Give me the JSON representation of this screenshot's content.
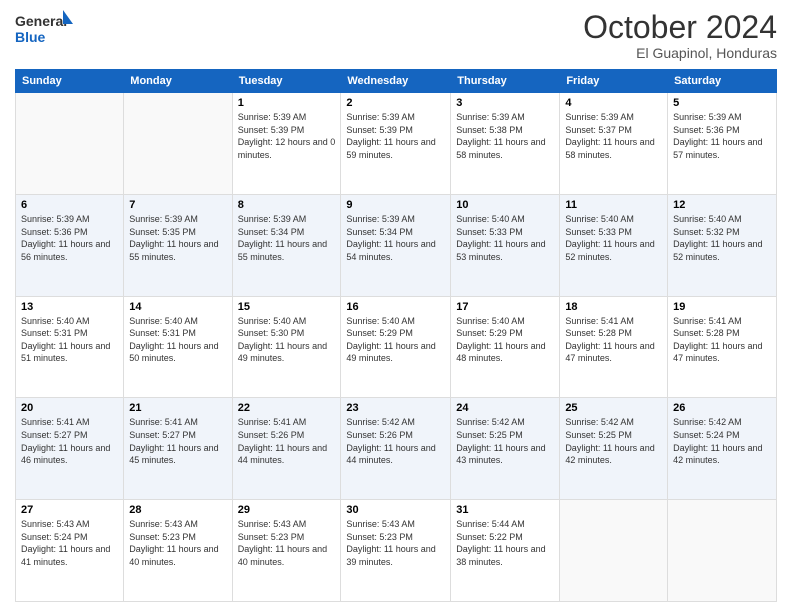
{
  "logo": {
    "line1": "General",
    "line2": "Blue"
  },
  "header": {
    "month": "October 2024",
    "location": "El Guapinol, Honduras"
  },
  "weekdays": [
    "Sunday",
    "Monday",
    "Tuesday",
    "Wednesday",
    "Thursday",
    "Friday",
    "Saturday"
  ],
  "weeks": [
    [
      {
        "day": "",
        "sunrise": "",
        "sunset": "",
        "daylight": ""
      },
      {
        "day": "",
        "sunrise": "",
        "sunset": "",
        "daylight": ""
      },
      {
        "day": "1",
        "sunrise": "Sunrise: 5:39 AM",
        "sunset": "Sunset: 5:39 PM",
        "daylight": "Daylight: 12 hours and 0 minutes."
      },
      {
        "day": "2",
        "sunrise": "Sunrise: 5:39 AM",
        "sunset": "Sunset: 5:39 PM",
        "daylight": "Daylight: 11 hours and 59 minutes."
      },
      {
        "day": "3",
        "sunrise": "Sunrise: 5:39 AM",
        "sunset": "Sunset: 5:38 PM",
        "daylight": "Daylight: 11 hours and 58 minutes."
      },
      {
        "day": "4",
        "sunrise": "Sunrise: 5:39 AM",
        "sunset": "Sunset: 5:37 PM",
        "daylight": "Daylight: 11 hours and 58 minutes."
      },
      {
        "day": "5",
        "sunrise": "Sunrise: 5:39 AM",
        "sunset": "Sunset: 5:36 PM",
        "daylight": "Daylight: 11 hours and 57 minutes."
      }
    ],
    [
      {
        "day": "6",
        "sunrise": "Sunrise: 5:39 AM",
        "sunset": "Sunset: 5:36 PM",
        "daylight": "Daylight: 11 hours and 56 minutes."
      },
      {
        "day": "7",
        "sunrise": "Sunrise: 5:39 AM",
        "sunset": "Sunset: 5:35 PM",
        "daylight": "Daylight: 11 hours and 55 minutes."
      },
      {
        "day": "8",
        "sunrise": "Sunrise: 5:39 AM",
        "sunset": "Sunset: 5:34 PM",
        "daylight": "Daylight: 11 hours and 55 minutes."
      },
      {
        "day": "9",
        "sunrise": "Sunrise: 5:39 AM",
        "sunset": "Sunset: 5:34 PM",
        "daylight": "Daylight: 11 hours and 54 minutes."
      },
      {
        "day": "10",
        "sunrise": "Sunrise: 5:40 AM",
        "sunset": "Sunset: 5:33 PM",
        "daylight": "Daylight: 11 hours and 53 minutes."
      },
      {
        "day": "11",
        "sunrise": "Sunrise: 5:40 AM",
        "sunset": "Sunset: 5:33 PM",
        "daylight": "Daylight: 11 hours and 52 minutes."
      },
      {
        "day": "12",
        "sunrise": "Sunrise: 5:40 AM",
        "sunset": "Sunset: 5:32 PM",
        "daylight": "Daylight: 11 hours and 52 minutes."
      }
    ],
    [
      {
        "day": "13",
        "sunrise": "Sunrise: 5:40 AM",
        "sunset": "Sunset: 5:31 PM",
        "daylight": "Daylight: 11 hours and 51 minutes."
      },
      {
        "day": "14",
        "sunrise": "Sunrise: 5:40 AM",
        "sunset": "Sunset: 5:31 PM",
        "daylight": "Daylight: 11 hours and 50 minutes."
      },
      {
        "day": "15",
        "sunrise": "Sunrise: 5:40 AM",
        "sunset": "Sunset: 5:30 PM",
        "daylight": "Daylight: 11 hours and 49 minutes."
      },
      {
        "day": "16",
        "sunrise": "Sunrise: 5:40 AM",
        "sunset": "Sunset: 5:29 PM",
        "daylight": "Daylight: 11 hours and 49 minutes."
      },
      {
        "day": "17",
        "sunrise": "Sunrise: 5:40 AM",
        "sunset": "Sunset: 5:29 PM",
        "daylight": "Daylight: 11 hours and 48 minutes."
      },
      {
        "day": "18",
        "sunrise": "Sunrise: 5:41 AM",
        "sunset": "Sunset: 5:28 PM",
        "daylight": "Daylight: 11 hours and 47 minutes."
      },
      {
        "day": "19",
        "sunrise": "Sunrise: 5:41 AM",
        "sunset": "Sunset: 5:28 PM",
        "daylight": "Daylight: 11 hours and 47 minutes."
      }
    ],
    [
      {
        "day": "20",
        "sunrise": "Sunrise: 5:41 AM",
        "sunset": "Sunset: 5:27 PM",
        "daylight": "Daylight: 11 hours and 46 minutes."
      },
      {
        "day": "21",
        "sunrise": "Sunrise: 5:41 AM",
        "sunset": "Sunset: 5:27 PM",
        "daylight": "Daylight: 11 hours and 45 minutes."
      },
      {
        "day": "22",
        "sunrise": "Sunrise: 5:41 AM",
        "sunset": "Sunset: 5:26 PM",
        "daylight": "Daylight: 11 hours and 44 minutes."
      },
      {
        "day": "23",
        "sunrise": "Sunrise: 5:42 AM",
        "sunset": "Sunset: 5:26 PM",
        "daylight": "Daylight: 11 hours and 44 minutes."
      },
      {
        "day": "24",
        "sunrise": "Sunrise: 5:42 AM",
        "sunset": "Sunset: 5:25 PM",
        "daylight": "Daylight: 11 hours and 43 minutes."
      },
      {
        "day": "25",
        "sunrise": "Sunrise: 5:42 AM",
        "sunset": "Sunset: 5:25 PM",
        "daylight": "Daylight: 11 hours and 42 minutes."
      },
      {
        "day": "26",
        "sunrise": "Sunrise: 5:42 AM",
        "sunset": "Sunset: 5:24 PM",
        "daylight": "Daylight: 11 hours and 42 minutes."
      }
    ],
    [
      {
        "day": "27",
        "sunrise": "Sunrise: 5:43 AM",
        "sunset": "Sunset: 5:24 PM",
        "daylight": "Daylight: 11 hours and 41 minutes."
      },
      {
        "day": "28",
        "sunrise": "Sunrise: 5:43 AM",
        "sunset": "Sunset: 5:23 PM",
        "daylight": "Daylight: 11 hours and 40 minutes."
      },
      {
        "day": "29",
        "sunrise": "Sunrise: 5:43 AM",
        "sunset": "Sunset: 5:23 PM",
        "daylight": "Daylight: 11 hours and 40 minutes."
      },
      {
        "day": "30",
        "sunrise": "Sunrise: 5:43 AM",
        "sunset": "Sunset: 5:23 PM",
        "daylight": "Daylight: 11 hours and 39 minutes."
      },
      {
        "day": "31",
        "sunrise": "Sunrise: 5:44 AM",
        "sunset": "Sunset: 5:22 PM",
        "daylight": "Daylight: 11 hours and 38 minutes."
      },
      {
        "day": "",
        "sunrise": "",
        "sunset": "",
        "daylight": ""
      },
      {
        "day": "",
        "sunrise": "",
        "sunset": "",
        "daylight": ""
      }
    ]
  ]
}
